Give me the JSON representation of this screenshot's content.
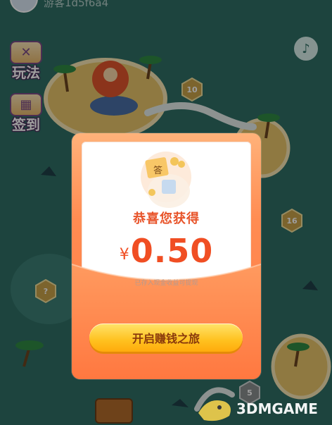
{
  "header": {
    "username": "游客1d5f6a4"
  },
  "sidebar": {
    "rules_label": "玩法",
    "checkin_label": "签到"
  },
  "map": {
    "levels": [
      "10",
      "16",
      "5",
      "?"
    ]
  },
  "dialog": {
    "title": "恭喜您获得",
    "currency": "¥",
    "amount": "0.50",
    "note": "已存入现金收益可提现",
    "cta_label": "开启赚钱之旅",
    "badge_text": "答"
  },
  "watermark": {
    "text": "3DMGAME"
  },
  "colors": {
    "background": "#2f6f65",
    "dialog": "#ff8c52",
    "accent": "#f04e23",
    "button": "#ffc11f"
  }
}
